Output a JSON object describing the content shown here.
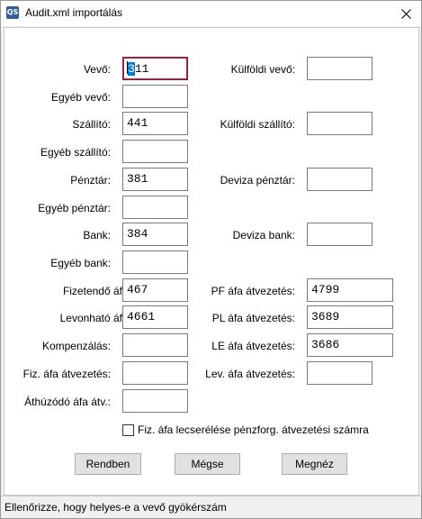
{
  "window": {
    "title": "Audit.xml importálás",
    "app_icon_text": "QS"
  },
  "form": {
    "vevo": {
      "label": "Vevő:",
      "value_selected": "3",
      "value_rest": "11"
    },
    "kulfoldi_vevo": {
      "label": "Külföldi vevő:",
      "value": ""
    },
    "egyeb_vevo": {
      "label": "Egyéb vevő:",
      "value": ""
    },
    "szallito": {
      "label": "Szállító:",
      "value": "441"
    },
    "kulfoldi_szallito": {
      "label": "Külföldi szállító:",
      "value": ""
    },
    "egyeb_szallito": {
      "label": "Egyéb szállító:",
      "value": ""
    },
    "penztar": {
      "label": "Pénztár:",
      "value": "381"
    },
    "deviza_penztar": {
      "label": "Deviza pénztár:",
      "value": ""
    },
    "egyeb_penztar": {
      "label": "Egyéb pénztár:",
      "value": ""
    },
    "bank": {
      "label": "Bank:",
      "value": "384"
    },
    "deviza_bank": {
      "label": "Deviza bank:",
      "value": ""
    },
    "egyeb_bank": {
      "label": "Egyéb bank:",
      "value": ""
    },
    "fizetendo_afa": {
      "label": "Fizetendő áfa:",
      "value": "467"
    },
    "pf_afa": {
      "label": "PF áfa átvezetés:",
      "value": "4799"
    },
    "levonhato_afa": {
      "label": "Levonható áfa:",
      "value": "4661"
    },
    "pl_afa": {
      "label": "PL áfa átvezetés:",
      "value": "3689"
    },
    "kompenzalas": {
      "label": "Kompenzálás:",
      "value": ""
    },
    "le_afa": {
      "label": "LE áfa átvezetés:",
      "value": "3686"
    },
    "fiz_afa": {
      "label": "Fiz. áfa átvezetés:",
      "value": ""
    },
    "lev_afa": {
      "label": "Lev. áfa átvezetés:",
      "value": ""
    },
    "athuzodo_afa": {
      "label": "Áthúzódó áfa átv.:",
      "value": ""
    },
    "replace_checkbox": {
      "label": "Fiz. áfa lecserélése pénzforg. átvezetési számra",
      "checked": false
    }
  },
  "buttons": {
    "ok": "Rendben",
    "cancel": "Mégse",
    "view": "Megnéz"
  },
  "status": {
    "text": "Ellenőrizze, hogy helyes-e a vevő gyökérszám"
  }
}
